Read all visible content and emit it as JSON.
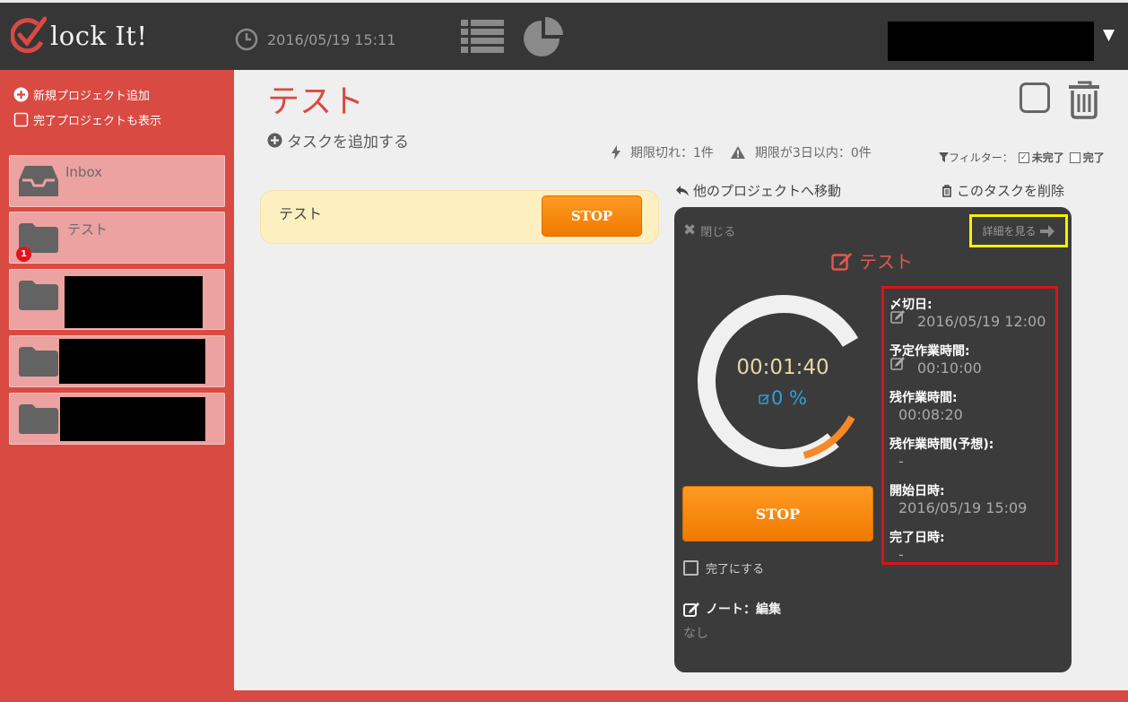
{
  "app": {
    "logo_text": "lock It!",
    "datetime": "2016/05/19 15:11"
  },
  "sidebar": {
    "add_project": "新規プロジェクト追加",
    "show_completed": "完了プロジェクトも表示",
    "projects": [
      {
        "label": "Inbox"
      },
      {
        "label": "テスト",
        "badge": "1"
      }
    ]
  },
  "main": {
    "title": "テスト",
    "add_task": "タスクを追加する",
    "expired": "期限切れ：1件",
    "due_soon": "期限が3日以内：0件",
    "filter_label": "フィルター：",
    "filter_incomplete": "未完了",
    "filter_complete": "完了",
    "move_project": "他のプロジェクトへ移動",
    "delete_task": "このタスクを削除"
  },
  "task": {
    "name": "テスト",
    "stop_label": "STOP"
  },
  "panel": {
    "close": "閉じる",
    "view_details": "詳細を見る",
    "title": "テスト",
    "timer": "00:01:40",
    "percent": "0 %",
    "progress_fraction": 0.1667,
    "stop_label": "STOP",
    "complete_label": "完了にする",
    "note_label": "ノート：編集",
    "note_value": "なし",
    "fields": {
      "deadline_label": "〆切日:",
      "deadline_value": "2016/05/19 12:00",
      "planned_label": "予定作業時間:",
      "planned_value": "00:10:00",
      "remaining_label": "残作業時間:",
      "remaining_value": "00:08:20",
      "remaining_est_label": "残作業時間(予想):",
      "remaining_est_value": "-",
      "start_label": "開始日時:",
      "start_value": "2016/05/19 15:09",
      "end_label": "完了日時:",
      "end_value": "-"
    }
  },
  "colors": {
    "accent_red": "#d94a42",
    "orange": "#f5892a",
    "highlight_yellow": "#f6f000",
    "highlight_red": "#d9141b",
    "percent_blue": "#2d9fd8"
  }
}
